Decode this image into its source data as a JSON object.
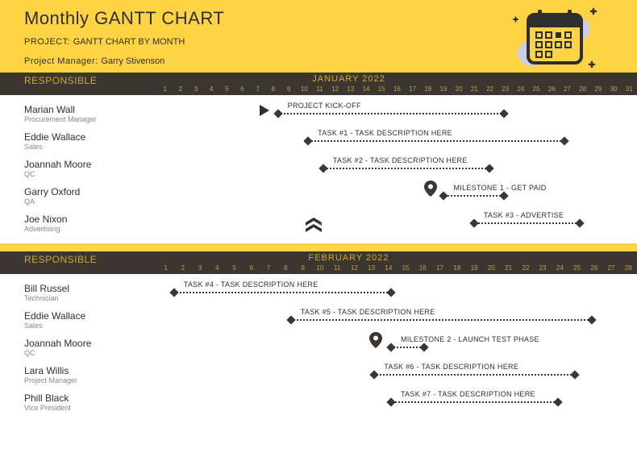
{
  "header": {
    "title": "Monthly GANTT CHART",
    "project_label": "PROJECT: ",
    "project_name": "GANTT CHART BY MONTH",
    "pm_label": "Project Manager: ",
    "pm_name": "Garry Stivenson"
  },
  "sections": {
    "responsible_label": "RESPONSIBLE",
    "jan": {
      "month_label": "JANUARY 2022",
      "days": 31,
      "rows": [
        {
          "name": "Marian Wall",
          "role": "Procurement Manager",
          "label": "PROJECT KICK-OFF",
          "kick_day": 8,
          "start": 9,
          "end": 24
        },
        {
          "name": "Eddie Wallace",
          "role": "Sales",
          "label": "TASK #1 - TASK DESCRIPTION HERE",
          "start": 11,
          "end": 28
        },
        {
          "name": "Joannah Moore",
          "role": "QC",
          "label": "TASK #2 - TASK DESCRIPTION HERE",
          "start": 12,
          "end": 23
        },
        {
          "name": "Garry Oxford",
          "role": "QA",
          "label": "MILESTONE 1 - GET PAID",
          "pin_day": 19,
          "start": 20,
          "end": 24
        },
        {
          "name": "Joe Nixon",
          "role": "Advertising",
          "label": "TASK #3 - ADVERTISE",
          "start": 22,
          "end": 29
        }
      ]
    },
    "feb": {
      "month_label": "FEBRUARY 2022",
      "days": 28,
      "rows": [
        {
          "name": "Bill Russel",
          "role": "Technician",
          "label": "TASK #4 - TASK DESCRIPTION HERE",
          "start": 2,
          "end": 15
        },
        {
          "name": "Eddie Wallace",
          "role": "Sales",
          "label": "TASK #5 - TASK DESCRIPTION HERE",
          "start": 9,
          "end": 27
        },
        {
          "name": "Joannah Moore",
          "role": "QC",
          "label": "MILESTONE 2 - LAUNCH TEST PHASE",
          "pin_day": 14,
          "start": 15,
          "end": 17
        },
        {
          "name": "Lara Willis",
          "role": "Project Manager",
          "label": "TASK #6 - TASK DESCRIPTION HERE",
          "start": 14,
          "end": 26
        },
        {
          "name": "Phill Black",
          "role": "Vice President",
          "label": "TASK #7 - TASK DESCRIPTION HERE",
          "start": 15,
          "end": 25
        }
      ]
    }
  },
  "chart_data": [
    {
      "type": "gantt",
      "title": "JANUARY 2022",
      "x_range": [
        1,
        31
      ],
      "series": [
        {
          "name": "Marian Wall",
          "role": "Procurement Manager",
          "task": "PROJECT KICK-OFF",
          "start": 9,
          "end": 24,
          "kickoff_marker": 8
        },
        {
          "name": "Eddie Wallace",
          "role": "Sales",
          "task": "TASK #1 - TASK DESCRIPTION HERE",
          "start": 11,
          "end": 28
        },
        {
          "name": "Joannah Moore",
          "role": "QC",
          "task": "TASK #2 - TASK DESCRIPTION HERE",
          "start": 12,
          "end": 23
        },
        {
          "name": "Garry Oxford",
          "role": "QA",
          "task": "MILESTONE 1 - GET PAID",
          "start": 20,
          "end": 24,
          "milestone_marker": 19
        },
        {
          "name": "Joe Nixon",
          "role": "Advertising",
          "task": "TASK #3 - ADVERTISE",
          "start": 22,
          "end": 29
        }
      ]
    },
    {
      "type": "gantt",
      "title": "FEBRUARY 2022",
      "x_range": [
        1,
        28
      ],
      "series": [
        {
          "name": "Bill Russel",
          "role": "Technician",
          "task": "TASK #4 - TASK DESCRIPTION HERE",
          "start": 2,
          "end": 15
        },
        {
          "name": "Eddie Wallace",
          "role": "Sales",
          "task": "TASK #5 - TASK DESCRIPTION HERE",
          "start": 9,
          "end": 27
        },
        {
          "name": "Joannah Moore",
          "role": "QC",
          "task": "MILESTONE 2 - LAUNCH TEST PHASE",
          "start": 15,
          "end": 17,
          "milestone_marker": 14
        },
        {
          "name": "Lara Willis",
          "role": "Project Manager",
          "task": "TASK #6 - TASK DESCRIPTION HERE",
          "start": 14,
          "end": 26
        },
        {
          "name": "Phill Black",
          "role": "Vice President",
          "task": "TASK #7 - TASK DESCRIPTION HERE",
          "start": 15,
          "end": 25
        }
      ]
    }
  ]
}
